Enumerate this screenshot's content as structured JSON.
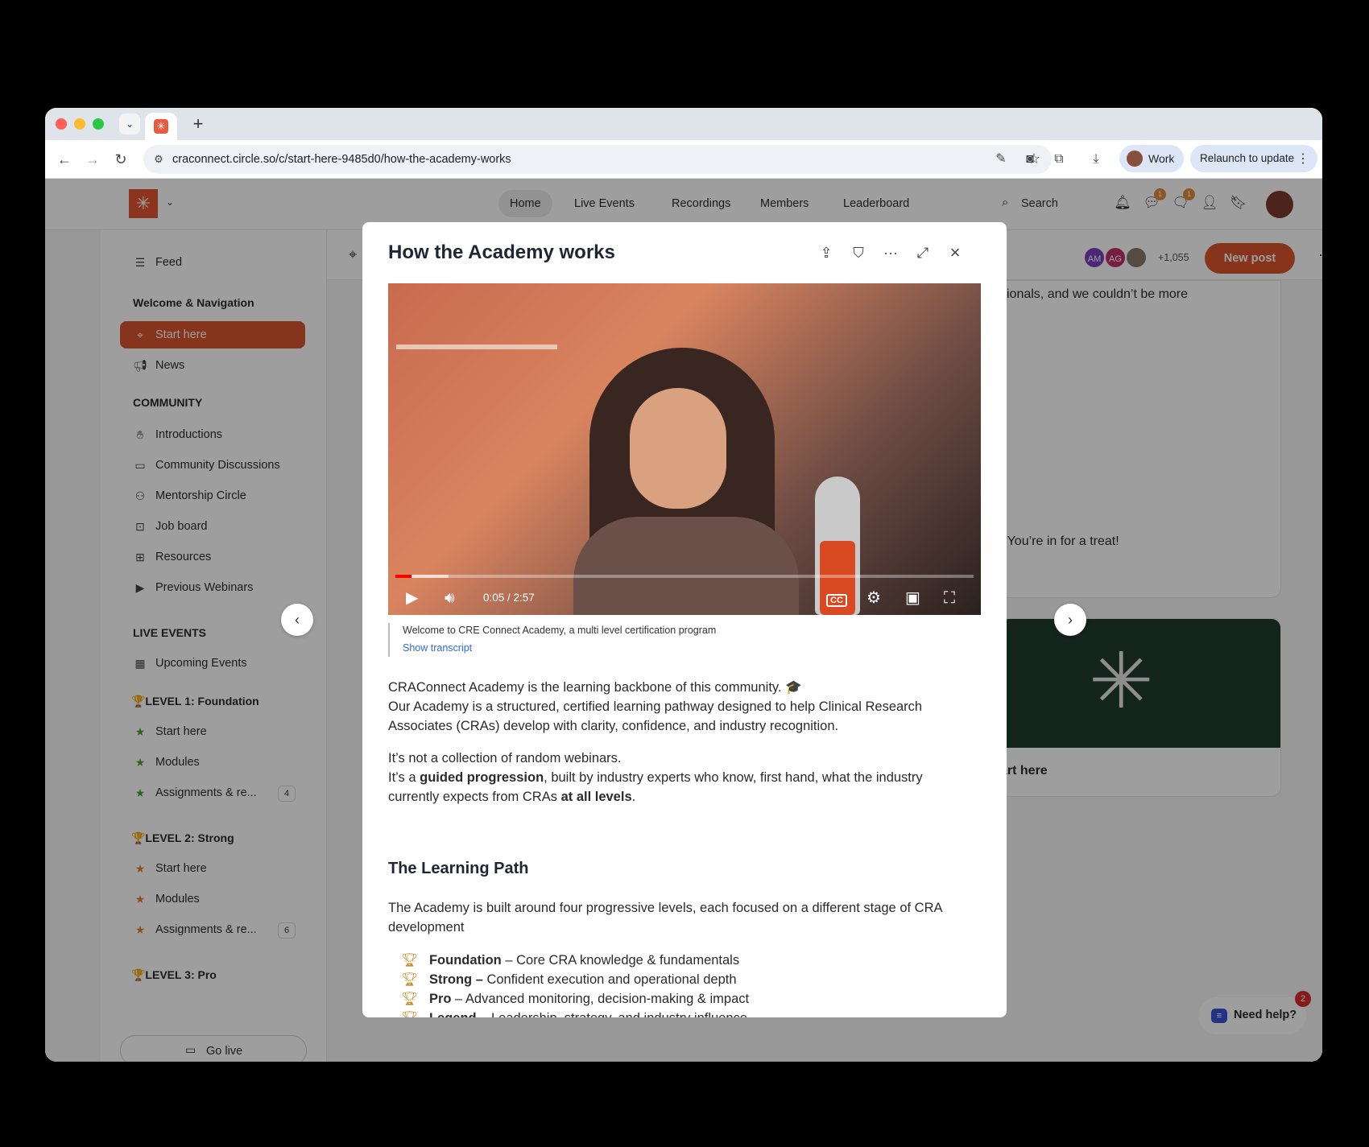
{
  "browser": {
    "url": "craconnect.circle.so/c/start-here-9485d0/how-the-academy-works",
    "profile_name": "Work",
    "relaunch_label": "Relaunch to update"
  },
  "topnav": {
    "links": [
      "Home",
      "Live Events",
      "Recordings",
      "Members",
      "Leaderboard"
    ],
    "search_label": "Search",
    "badges": {
      "chat": "1",
      "messages": "1"
    }
  },
  "sidebar": {
    "feed": "Feed",
    "welcome_heading": "Welcome & Navigation",
    "start_here": "Start here",
    "news": "News",
    "community_heading": "COMMUNITY",
    "community_items": [
      "Introductions",
      "Community Discussions",
      "Mentorship Circle",
      "Job board",
      "Resources",
      "Previous Webinars"
    ],
    "live_heading": "LIVE EVENTS",
    "upcoming": "Upcoming Events",
    "level1_heading": "🏆LEVEL 1: Foundation",
    "level1_items": [
      "Start here",
      "Modules",
      "Assignments & re..."
    ],
    "level1_badge": "4",
    "level2_heading": "🏆LEVEL 2: Strong",
    "level2_items": [
      "Start here",
      "Modules",
      "Assignments & re..."
    ],
    "level2_badge": "6",
    "level3_heading": "🏆LEVEL 3: Pro",
    "go_live": "Go live"
  },
  "main": {
    "avatars": [
      "AM",
      "AG"
    ],
    "member_count": "+1,055",
    "new_post": "New post",
    "post_text_1": "sionals, and we couldn’t be more",
    "post_text_2": ". You’re in for a treat!",
    "course_title": "art here"
  },
  "help": {
    "label": "Need help?",
    "badge": "2"
  },
  "modal": {
    "title": "How the Academy works",
    "video": {
      "time": "0:05 / 2:57",
      "progress": 0.028,
      "caption": "Welcome to CRE Connect Academy, a multi level certification program",
      "show_transcript": "Show transcript"
    },
    "p1_line1": "CRAConnect Academy is the learning backbone of this community. 🎓",
    "p1_line2": "Our Academy is a structured, certified learning pathway designed to help Clinical Research Associates (CRAs) develop with clarity, confidence, and industry recognition.",
    "p2_line1": "It’s not a collection of random webinars.",
    "p2_a": "It’s a ",
    "p2_b": "guided progression",
    "p2_c": ", built by industry experts who know, first hand, what the industry currently expects from CRAs ",
    "p2_d": "at all levels",
    "p2_e": ".",
    "section_heading": "The Learning Path",
    "p3": "The Academy is built around four progressive levels, each focused on a different stage of CRA development",
    "levels": [
      {
        "name": "Foundation",
        "desc": " – Core CRA knowledge & fundamentals"
      },
      {
        "name": "Strong –",
        "desc": " Confident execution and operational depth"
      },
      {
        "name": "Pro",
        "desc": " – Advanced monitoring, decision-making & impact"
      },
      {
        "name": "Legend –",
        "desc": " Leadership, strategy, and industry influence"
      }
    ]
  }
}
